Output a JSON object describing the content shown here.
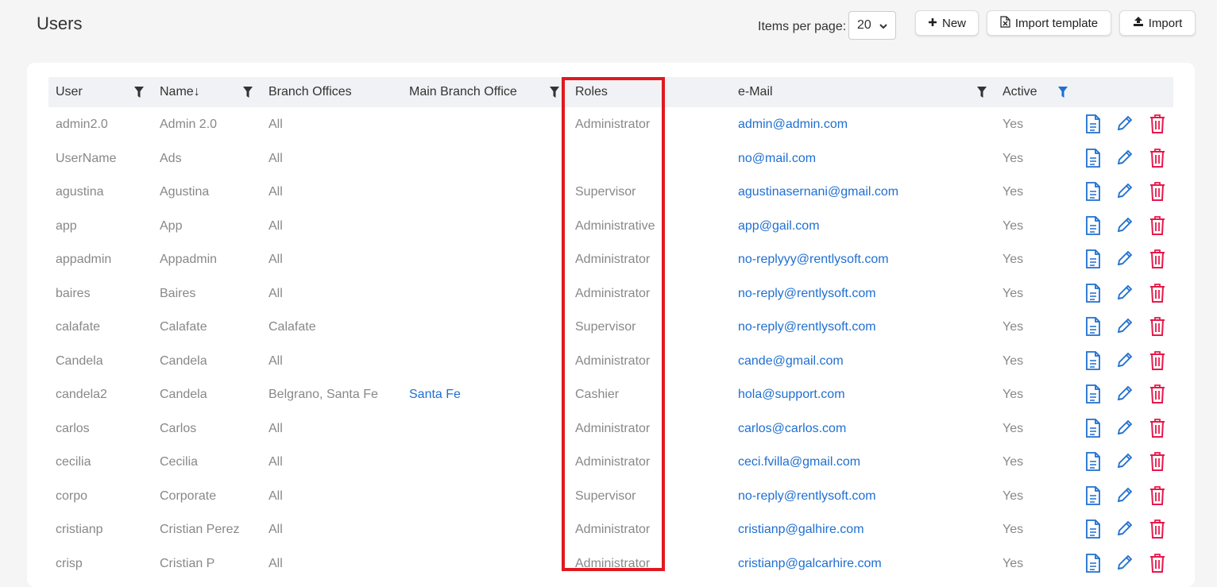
{
  "page": {
    "title": "Users"
  },
  "toolbar": {
    "items_per_page_label": "Items per page:",
    "items_per_page_value": "20",
    "new_label": "New",
    "import_template_label": "Import template",
    "import_label": "Import"
  },
  "table": {
    "headers": {
      "user": "User",
      "name": "Name",
      "name_sort": "↓",
      "branch_offices": "Branch Offices",
      "main_branch_office": "Main Branch Office",
      "roles": "Roles",
      "email": "e-Mail",
      "active": "Active"
    },
    "rows": [
      {
        "user": "admin2.0",
        "name": "Admin 2.0",
        "branch": "All",
        "main_branch": "",
        "role": "Administrator",
        "email": "admin@admin.com",
        "active": "Yes"
      },
      {
        "user": "UserName",
        "name": "Ads",
        "branch": "All",
        "main_branch": "",
        "role": "",
        "email": "no@mail.com",
        "active": "Yes"
      },
      {
        "user": "agustina",
        "name": "Agustina",
        "branch": "All",
        "main_branch": "",
        "role": "Supervisor",
        "email": "agustinasernani@gmail.com",
        "active": "Yes"
      },
      {
        "user": "app",
        "name": "App",
        "branch": "All",
        "main_branch": "",
        "role": "Administrative",
        "email": "app@gail.com",
        "active": "Yes"
      },
      {
        "user": "appadmin",
        "name": "Appadmin",
        "branch": "All",
        "main_branch": "",
        "role": "Administrator",
        "email": "no-replyyy@rentlysoft.com",
        "active": "Yes"
      },
      {
        "user": "baires",
        "name": "Baires",
        "branch": "All",
        "main_branch": "",
        "role": "Administrator",
        "email": "no-reply@rentlysoft.com",
        "active": "Yes"
      },
      {
        "user": "calafate",
        "name": "Calafate",
        "branch": "Calafate",
        "main_branch": "",
        "role": "Supervisor",
        "email": "no-reply@rentlysoft.com",
        "active": "Yes"
      },
      {
        "user": "Candela",
        "name": "Candela",
        "branch": "All",
        "main_branch": "",
        "role": "Administrator",
        "email": "cande@gmail.com",
        "active": "Yes"
      },
      {
        "user": "candela2",
        "name": "Candela",
        "branch": "Belgrano, Santa Fe",
        "main_branch": "Santa Fe",
        "role": "Cashier",
        "email": "hola@support.com",
        "active": "Yes"
      },
      {
        "user": "carlos",
        "name": "Carlos",
        "branch": "All",
        "main_branch": "",
        "role": "Administrator",
        "email": "carlos@carlos.com",
        "active": "Yes"
      },
      {
        "user": "cecilia",
        "name": "Cecilia",
        "branch": "All",
        "main_branch": "",
        "role": "Administrator",
        "email": "ceci.fvilla@gmail.com",
        "active": "Yes"
      },
      {
        "user": "corpo",
        "name": "Corporate",
        "branch": "All",
        "main_branch": "",
        "role": "Supervisor",
        "email": "no-reply@rentlysoft.com",
        "active": "Yes"
      },
      {
        "user": "cristianp",
        "name": "Cristian Perez",
        "branch": "All",
        "main_branch": "",
        "role": "Administrator",
        "email": "cristianp@galhire.com",
        "active": "Yes"
      },
      {
        "user": "crisp",
        "name": "Cristian P",
        "branch": "All",
        "main_branch": "",
        "role": "Administrator",
        "email": "cristianp@galcarhire.com",
        "active": "Yes"
      }
    ]
  },
  "icons": {
    "new": "plus-icon",
    "import_template": "excel-file-icon",
    "import": "upload-icon",
    "filter": "filter-icon",
    "view": "document-icon",
    "edit": "pencil-icon",
    "delete": "trash-icon"
  },
  "colors": {
    "link": "#1f6fd1",
    "delete": "#e6194b",
    "highlight": "#e0191f",
    "active_filter": "#1f6fd1"
  }
}
